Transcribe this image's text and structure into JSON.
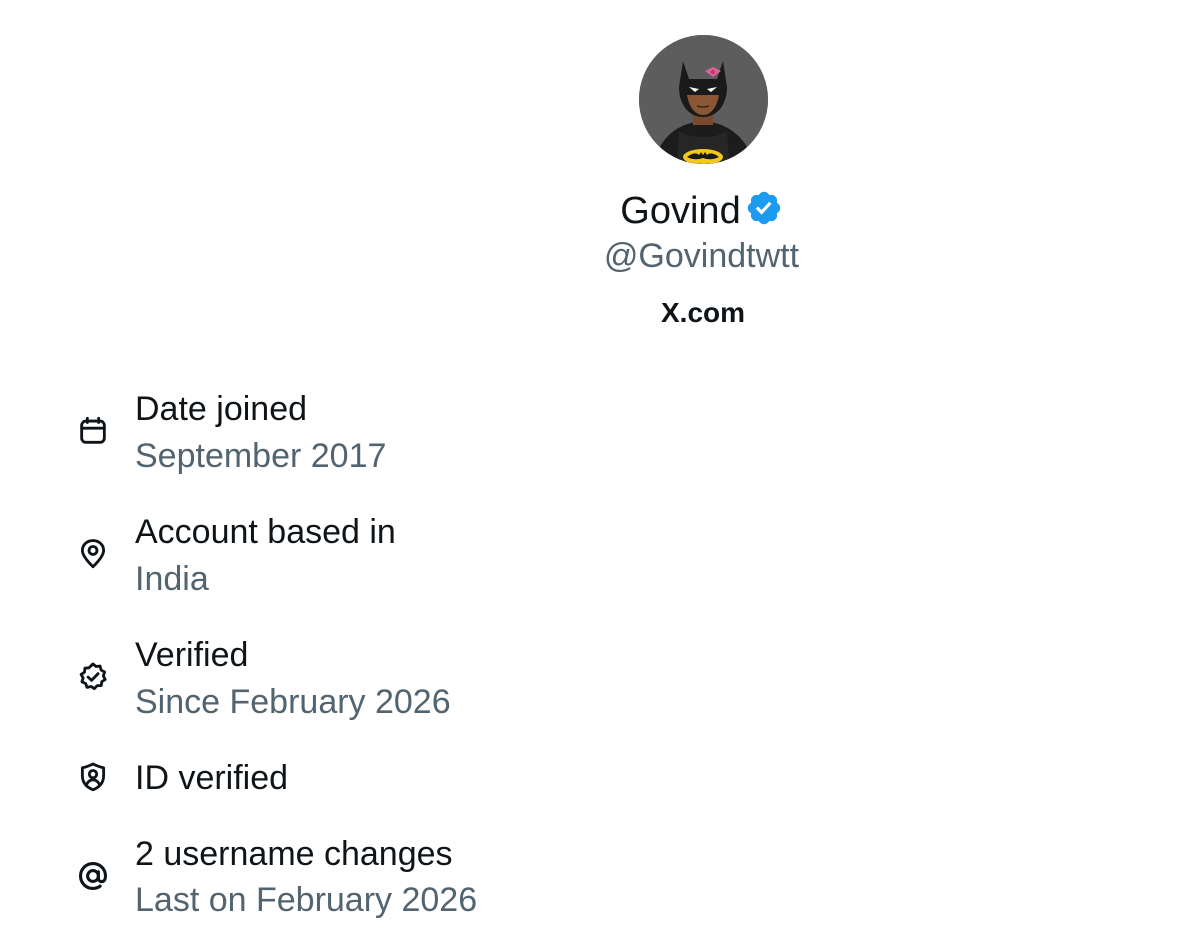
{
  "profile": {
    "display_name": "Govind",
    "handle": "@Govindtwtt",
    "site": "X.com",
    "avatar_icon": "batman-avatar",
    "verified_icon": "verified-badge-icon",
    "verified_color": "#1d9bf0"
  },
  "details": [
    {
      "icon": "calendar-icon",
      "label": "Date joined",
      "value": "September 2017"
    },
    {
      "icon": "location-pin-icon",
      "label": "Account based in",
      "value": "India"
    },
    {
      "icon": "verified-check-icon",
      "label": "Verified",
      "value": "Since February 2026"
    },
    {
      "icon": "id-shield-icon",
      "label": "ID verified",
      "value": ""
    },
    {
      "icon": "at-sign-icon",
      "label": "2 username changes",
      "value": "Last on February 2026"
    }
  ],
  "colors": {
    "text_primary": "#0f1419",
    "text_secondary": "#536471",
    "accent": "#1d9bf0",
    "background": "#ffffff"
  }
}
